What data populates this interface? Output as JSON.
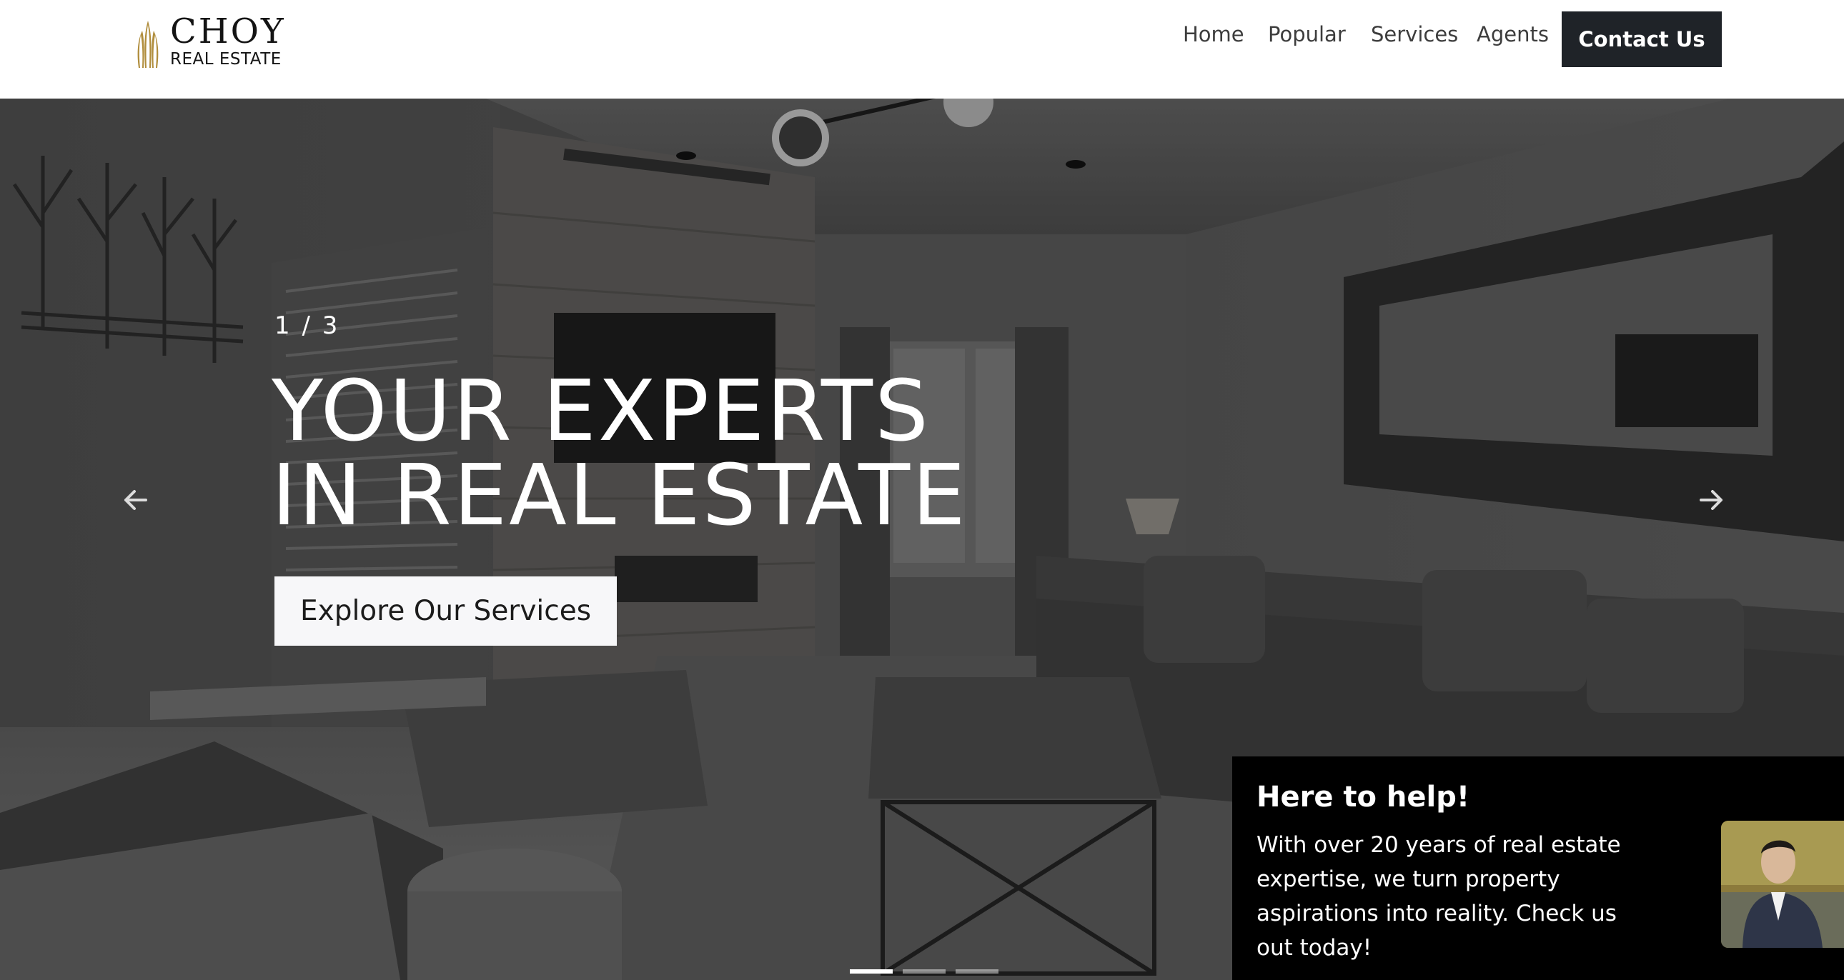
{
  "brand": {
    "name": "CHOY",
    "subtitle": "REAL ESTATE",
    "gold": "#b08d3c"
  },
  "nav": {
    "items": [
      {
        "label": "Home"
      },
      {
        "label": "Popular"
      },
      {
        "label": "Services"
      },
      {
        "label": "Agents"
      }
    ],
    "contact_label": "Contact Us"
  },
  "hero": {
    "counter": "1 / 3",
    "headline_line1": "YOUR EXPERTS",
    "headline_line2": "IN REAL ESTATE",
    "cta_label": "Explore Our Services",
    "prev_icon": "arrow-left-icon",
    "next_icon": "arrow-right-icon",
    "slide_count": 3,
    "active_slide": 1
  },
  "help": {
    "title": "Here to help!",
    "text": "With over 20 years of real estate expertise, we turn property aspirations into reality. Check us out today!"
  },
  "colors": {
    "dark_button": "#1f2328",
    "card_bg": "#000000",
    "hero_text": "#ffffff"
  }
}
